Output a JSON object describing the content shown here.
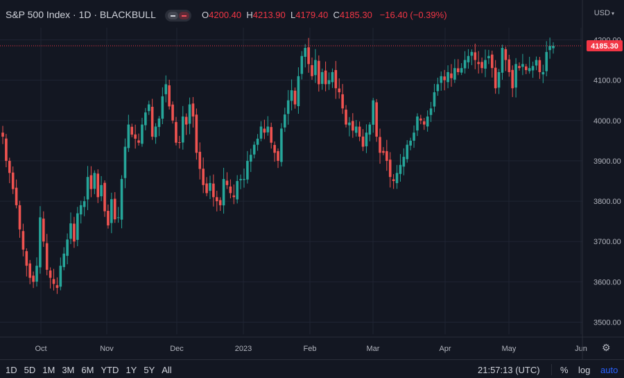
{
  "header": {
    "symbol": "S&P 500 Index · 1D · BLACKBULL",
    "ohlc": {
      "o_key": "O",
      "o_val": "4200.40",
      "h_key": "H",
      "h_val": "4213.90",
      "l_key": "L",
      "l_val": "4179.40",
      "c_key": "C",
      "c_val": "4185.30",
      "change": "−16.40 (−0.39%)"
    },
    "currency": "USD"
  },
  "footer": {
    "ranges": [
      "1D",
      "5D",
      "1M",
      "3M",
      "6M",
      "YTD",
      "1Y",
      "5Y",
      "All"
    ],
    "clock": "21:57:13 (UTC)",
    "percent": "%",
    "log": "log",
    "auto": "auto"
  },
  "colors": {
    "up": "#26a69a",
    "down": "#ef5350",
    "background": "#131722",
    "grid": "#1f2433",
    "price_tag": "#f23645"
  },
  "chart_data": {
    "type": "candlestick",
    "ylim": [
      3470,
      4230
    ],
    "y_ticks": [
      3500,
      3600,
      3700,
      3800,
      3900,
      4000,
      4100,
      4200
    ],
    "y_tick_labels": [
      "3500.00",
      "3600.00",
      "3700.00",
      "3800.00",
      "3900.00",
      "4000.00",
      "4100.00",
      "4200.00"
    ],
    "x_tick_labels": [
      "Oct",
      "Nov",
      "Dec",
      "2023",
      "Feb",
      "Mar",
      "Apr",
      "May",
      "Jun"
    ],
    "last_price": 4185.3,
    "last_price_label": "4185.30",
    "closes": [
      3960,
      3900,
      3870,
      3830,
      3790,
      3730,
      3680,
      3640,
      3610,
      3600,
      3640,
      3760,
      3700,
      3630,
      3610,
      3595,
      3585,
      3640,
      3670,
      3705,
      3745,
      3700,
      3770,
      3790,
      3800,
      3860,
      3830,
      3870,
      3810,
      3840,
      3775,
      3740,
      3805,
      3755,
      3760,
      3855,
      3935,
      3990,
      3965,
      3955,
      3945,
      3990,
      4020,
      4040,
      3960,
      3985,
      4005,
      4060,
      4090,
      4035,
      4000,
      3945,
      3945,
      4010,
      3990,
      4040,
      4010,
      3920,
      3880,
      3840,
      3820,
      3845,
      3810,
      3800,
      3790,
      3855,
      3840,
      3820,
      3810,
      3850,
      3855,
      3855,
      3900,
      3915,
      3940,
      3955,
      3985,
      3970,
      3985,
      3945,
      3920,
      3900,
      3980,
      4015,
      4050,
      4075,
      4040,
      4110,
      4160,
      4180,
      4140,
      4110,
      4150,
      4090,
      4120,
      4090,
      4100,
      4120,
      4080,
      4070,
      4030,
      3990,
      3995,
      3975,
      3985,
      3960,
      3935,
      3970,
      3990,
      4050,
      3960,
      3920,
      3920,
      3900,
      3860,
      3850,
      3870,
      3890,
      3910,
      3940,
      3950,
      3970,
      4010,
      4000,
      3990,
      4010,
      4030,
      4070,
      4090,
      4110,
      4100,
      4120,
      4105,
      4130,
      4120,
      4130,
      4150,
      4160,
      4170,
      4150,
      4140,
      4130,
      4150,
      4160,
      4130,
      4080,
      4120,
      4180,
      4150,
      4120,
      4080,
      4140,
      4130,
      4140,
      4125,
      4130,
      4135,
      4150,
      4120,
      4120,
      4170,
      4185,
      4185.3
    ],
    "bar_dates": {
      "first_tick_month": "Oct",
      "note_units": "daily"
    }
  }
}
